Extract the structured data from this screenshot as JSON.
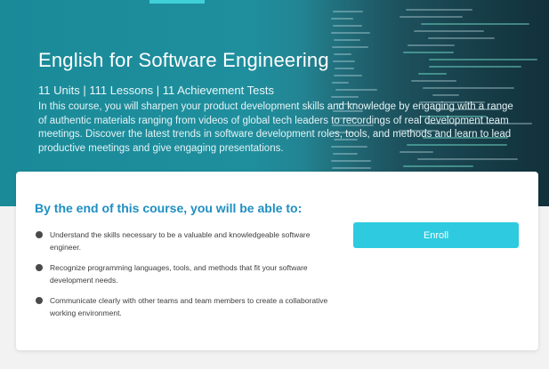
{
  "hero": {
    "title": "English for Software Engineering",
    "stats": "11 Units | 111 Lessons | 11 Achievement Tests",
    "description": "In this course, you will sharpen your product development skills and knowledge by engaging with a range of authentic materials ranging from videos of global tech leaders to recordings of real development team meetings. Discover the latest trends in software development roles, tools, and methods and learn to lead productive meetings and give engaging presentations."
  },
  "card": {
    "title": "By the end of this course, you will be able to:",
    "outcomes": [
      "Understand the skills necessary to be a valuable and knowledgeable software engineer.",
      "Recognize programming languages, tools, and methods that fit your software development needs.",
      "Communicate clearly with other teams and team members to create a collaborative working environment."
    ],
    "enroll_label": "Enroll"
  },
  "colors": {
    "hero_teal": "#1f8f9e",
    "accent_cyan": "#2ecbe0",
    "title_blue": "#1e8fc2"
  }
}
